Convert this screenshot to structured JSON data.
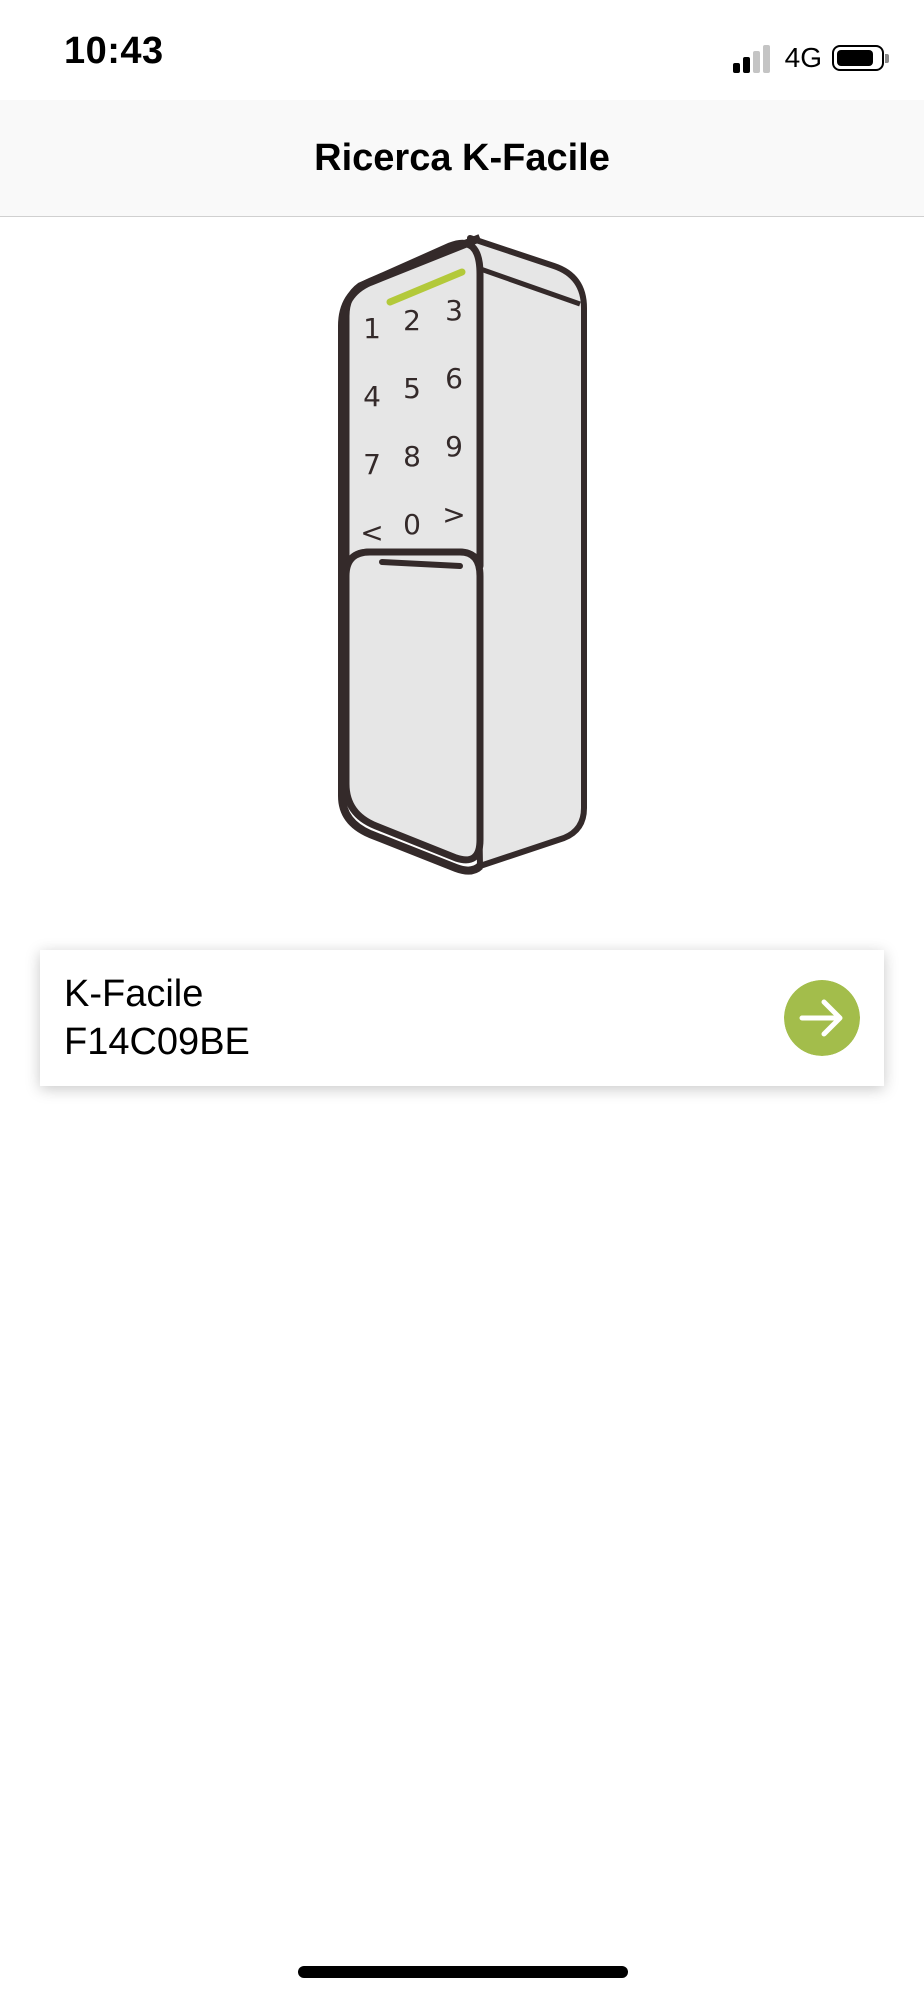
{
  "status_bar": {
    "time": "10:43",
    "network": "4G",
    "signal_bars_active": 2,
    "signal_bars_total": 4
  },
  "nav": {
    "title": "Ricerca K-Facile"
  },
  "illustration": {
    "keypad_keys": [
      "1",
      "2",
      "3",
      "4",
      "5",
      "6",
      "7",
      "8",
      "9",
      "<",
      "0",
      ">"
    ],
    "led_color": "#b3c93a",
    "body_color": "#e6e6e6",
    "outline_color": "#342a2a"
  },
  "device_list": [
    {
      "name": "K-Facile",
      "id": "F14C09BE",
      "action_icon": "arrow-right-icon"
    }
  ],
  "colors": {
    "accent": "#a3bd4b",
    "home_indicator": "#000000"
  }
}
